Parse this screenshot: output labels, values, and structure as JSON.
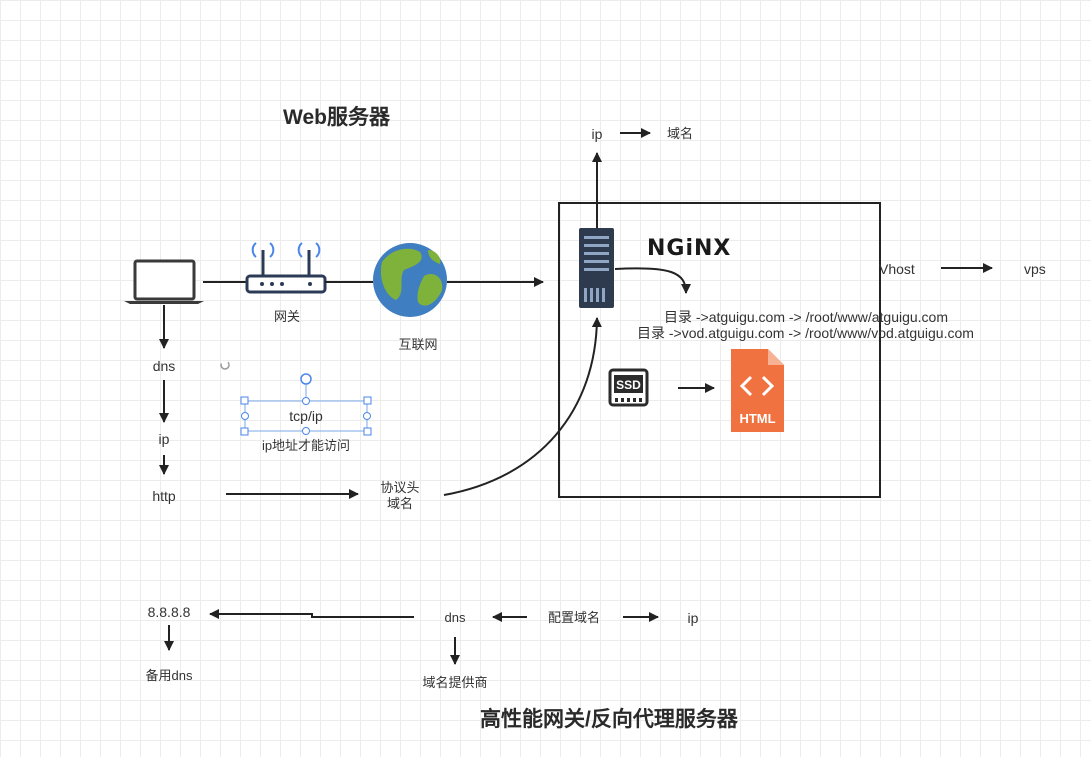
{
  "titles": {
    "web_server": "Web服务器",
    "gateway_proxy": "高性能网关/反向代理服务器"
  },
  "top": {
    "ip": "ip",
    "domain": "域名"
  },
  "devices": {
    "gateway": "网关",
    "internet": "互联网"
  },
  "logo": {
    "nginx": "NGiNX"
  },
  "vhost": {
    "label": "Vhost",
    "vps": "vps"
  },
  "dirs": {
    "line1": "目录 ->atguigu.com -> /root/www/atguigu.com",
    "line2": "目录 ->vod.atguigu.com -> /root/www/vod.atguigu.com"
  },
  "ssd": {
    "text": "SSD"
  },
  "html_file": {
    "text": "HTML"
  },
  "left_chain": {
    "dns": "dns",
    "ip": "ip",
    "http": "http"
  },
  "tcp": {
    "label": "tcp/ip",
    "note": "ip地址才能访问"
  },
  "protocol": {
    "line1": "协议头",
    "line2": "域名"
  },
  "bottom": {
    "dns_primary": "8.8.8.8",
    "dns_backup": "备用dns",
    "dns": "dns",
    "configure_domain": "配置域名",
    "ip": "ip",
    "provider": "域名提供商"
  },
  "colors": {
    "handle": "#4a86e8",
    "html_orange": "#f07240",
    "server_dark": "#2e3b4e",
    "globe_blue": "#3f7ec0",
    "globe_green": "#7fb23a"
  }
}
